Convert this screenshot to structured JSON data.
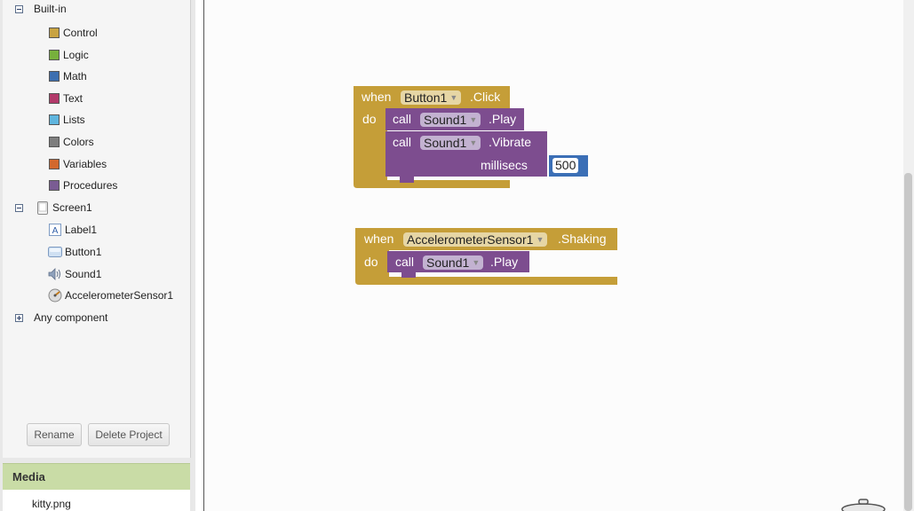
{
  "blocks_panel": {
    "builtin_label": "Built-in",
    "builtin_items": [
      {
        "label": "Control",
        "color": "#c8a342"
      },
      {
        "label": "Logic",
        "color": "#77b03c"
      },
      {
        "label": "Math",
        "color": "#3d6fb0"
      },
      {
        "label": "Text",
        "color": "#b23a6a"
      },
      {
        "label": "Lists",
        "color": "#5fb5de"
      },
      {
        "label": "Colors",
        "color": "#7e7e7e"
      },
      {
        "label": "Variables",
        "color": "#d2682d"
      },
      {
        "label": "Procedures",
        "color": "#7a5c93"
      }
    ],
    "screen_label": "Screen1",
    "components": [
      {
        "label": "Label1",
        "icon": "label-icon"
      },
      {
        "label": "Button1",
        "icon": "button-icon"
      },
      {
        "label": "Sound1",
        "icon": "speaker-icon"
      },
      {
        "label": "AccelerometerSensor1",
        "icon": "accelerometer-icon"
      }
    ],
    "any_component_label": "Any component",
    "rename_label": "Rename",
    "delete_label": "Delete Project"
  },
  "media": {
    "header": "Media",
    "items": [
      "kitty.png"
    ]
  },
  "workspace": {
    "colors": {
      "event": "#c59e38",
      "method": "#7d4d8f",
      "math": "#3b6fb6"
    },
    "block1": {
      "when": "when",
      "component": "Button1",
      "event": ".Click",
      "do": "do",
      "call1": {
        "call": "call",
        "component": "Sound1",
        "method": ".Play"
      },
      "call2": {
        "call": "call",
        "component": "Sound1",
        "method": ".Vibrate",
        "param": "millisecs",
        "value": "500"
      }
    },
    "block2": {
      "when": "when",
      "component": "AccelerometerSensor1",
      "event": ".Shaking",
      "do": "do",
      "call1": {
        "call": "call",
        "component": "Sound1",
        "method": ".Play"
      }
    }
  }
}
